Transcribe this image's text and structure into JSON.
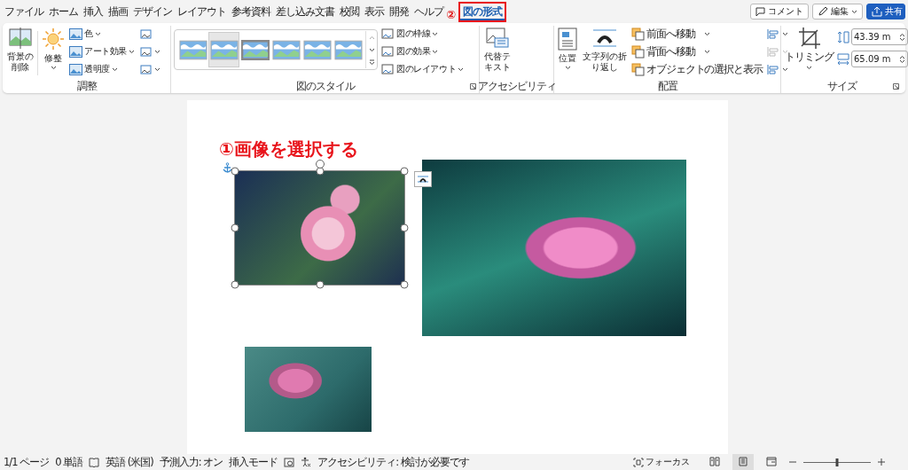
{
  "tabs": [
    {
      "label": "ファイル",
      "selected": false
    },
    {
      "label": "ホーム",
      "selected": false
    },
    {
      "label": "挿入",
      "selected": false
    },
    {
      "label": "描画",
      "selected": false
    },
    {
      "label": "デザイン",
      "selected": false
    },
    {
      "label": "レイアウト",
      "selected": false
    },
    {
      "label": "参考資料",
      "selected": false
    },
    {
      "label": "差し込み文書",
      "selected": false
    },
    {
      "label": "校閲",
      "selected": false
    },
    {
      "label": "表示",
      "selected": false
    },
    {
      "label": "開発",
      "selected": false
    },
    {
      "label": "ヘルプ",
      "selected": false
    },
    {
      "label": "図の形式",
      "selected": true
    }
  ],
  "step_marks": [
    "①画像を選択する",
    "②"
  ],
  "header_buttons": [
    {
      "label": "コメント",
      "kind": "comment"
    },
    {
      "label": "編集",
      "kind": "edit"
    },
    {
      "label": "共有",
      "kind": "share"
    }
  ],
  "adjust": {
    "label": "調整",
    "large": [
      "背景の削除",
      "修整"
    ],
    "small": [
      "色",
      "アート効果",
      "透明度"
    ]
  },
  "styles": {
    "label": "図のスタイル",
    "thumbs": [
      {
        "selected": false
      },
      {
        "selected": true
      },
      {
        "selected": false
      },
      {
        "selected": false
      },
      {
        "selected": false
      },
      {
        "selected": false
      }
    ],
    "small": [
      "図の枠線",
      "図の効果",
      "図のレイアウト"
    ]
  },
  "accessibility": {
    "label": "アクセシビリティ",
    "large": "代替テキスト"
  },
  "arrange": {
    "label": "配置",
    "large": [
      "位置",
      "文字列の折り返し"
    ],
    "small": [
      "前面へ移動",
      "背面へ移動",
      "オブジェクトの選択と表示"
    ]
  },
  "size": {
    "label": "サイズ",
    "large": "トリミング",
    "height": "43.39 m",
    "width": "65.09 m"
  },
  "images": [
    {
      "selected": true
    },
    {
      "selected": false
    },
    {
      "selected": false
    }
  ],
  "status": {
    "left": [
      "1/1 ページ",
      "0 単語",
      "英語 (米国)",
      "予測入力: オン",
      "挿入モード",
      "アクセシビリティ: 検討が必要です"
    ],
    "focus": "フォーカス",
    "views": [
      {
        "selected": false
      },
      {
        "selected": true
      },
      {
        "selected": false
      }
    ],
    "zoom": {
      "level": 0.5
    }
  }
}
